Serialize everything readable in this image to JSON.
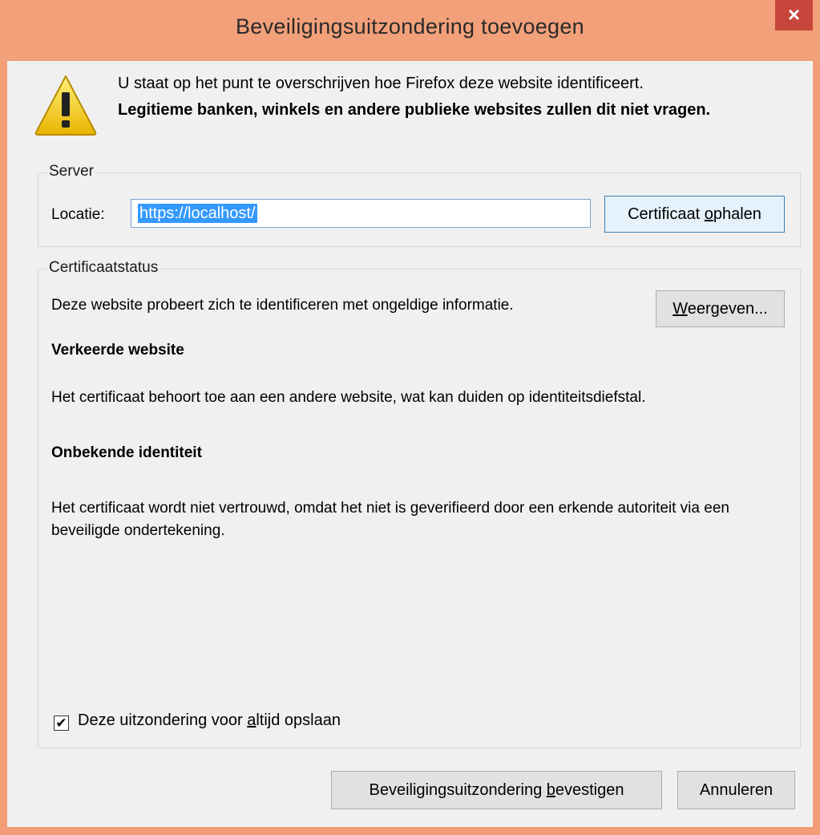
{
  "window": {
    "title": "Beveiligingsuitzondering toevoegen",
    "close_glyph": "×",
    "accent_color": "#f2a079"
  },
  "intro": {
    "line1": "U staat op het punt te overschrijven hoe Firefox deze website identificeert.",
    "line2": "Legitieme banken, winkels en andere publieke websites zullen dit niet vragen."
  },
  "server": {
    "group_label": "Server",
    "location_label": "Locatie:",
    "location_value": "https://localhost/",
    "get_cert_pre": "Certificaat ",
    "get_cert_key": "o",
    "get_cert_post": "phalen"
  },
  "status": {
    "group_label": "Certificaatstatus",
    "summary": "Deze website probeert zich te identificeren met ongeldige informatie.",
    "view_key": "W",
    "view_post": "eergeven...",
    "wrong_site_heading": "Verkeerde website",
    "wrong_site_text": "Het certificaat behoort toe aan een andere website, wat kan duiden op identiteitsdiefstal.",
    "unknown_heading": "Onbekende identiteit",
    "unknown_text": "Het certificaat wordt niet vertrouwd, omdat het niet is geverifieerd door een erkende autoriteit via een beveiligde ondertekening."
  },
  "permanent": {
    "checked": true,
    "check_glyph": "✔",
    "label_pre": "Deze uitzondering voor ",
    "label_key": "a",
    "label_post": "ltijd opslaan"
  },
  "buttons": {
    "confirm_pre": "Beveiligingsuitzondering ",
    "confirm_key": "b",
    "confirm_post": "evestigen",
    "cancel": "Annuleren"
  }
}
